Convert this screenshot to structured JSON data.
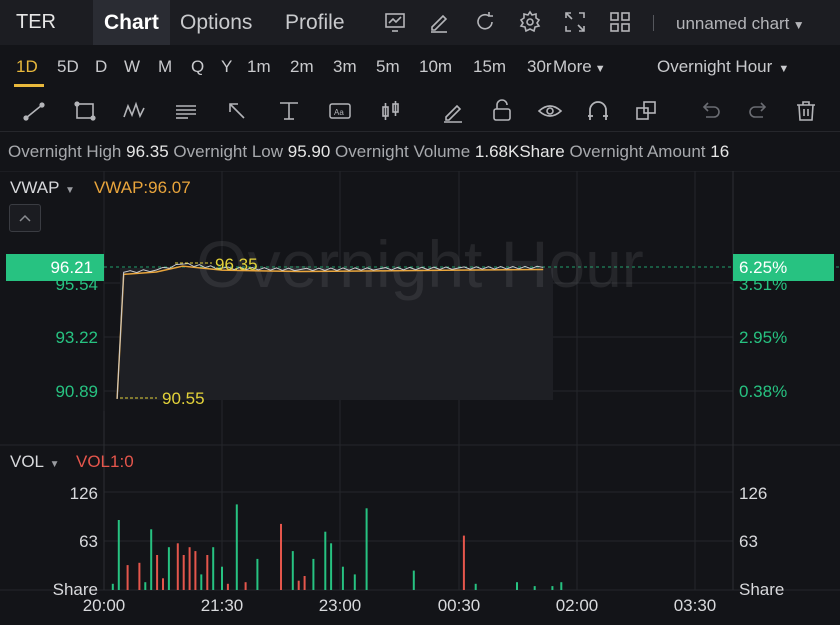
{
  "header": {
    "ticker": "TER",
    "tabs": [
      {
        "label": "Chart",
        "active": true
      },
      {
        "label": "Options",
        "active": false
      },
      {
        "label": "Profile",
        "active": false
      }
    ],
    "icons": [
      "chart-line-icon",
      "edit-icon",
      "refresh-icon",
      "settings-icon",
      "fullscreen-icon",
      "layout-grid-icon"
    ],
    "chart_name": "unnamed chart"
  },
  "periods": {
    "items": [
      "1D",
      "5D",
      "D",
      "W",
      "M",
      "Q",
      "Y",
      "1m",
      "2m",
      "3m",
      "5m",
      "10m",
      "15m",
      "30r",
      "More"
    ],
    "active": "1D",
    "session": "Overnight Hour"
  },
  "drawing_tools": [
    "trend-line-icon",
    "rectangle-icon",
    "pattern-icon",
    "text-note-icon",
    "arrow-icon",
    "price-range-icon",
    "text-box-icon",
    "candle-icon",
    "pen-icon",
    "lock-icon",
    "eye-icon",
    "magnet-icon",
    "layers-icon",
    "undo-icon",
    "redo-icon",
    "trash-icon"
  ],
  "info": {
    "high_label": "Overnight High",
    "high_value": "96.35",
    "low_label": "Overnight Low",
    "low_value": "95.90",
    "volume_label": "Overnight Volume",
    "volume_value": "1.68KShare",
    "amount_label": "Overnight Amount",
    "amount_value": "16"
  },
  "price_pane": {
    "indicator": "VWAP",
    "indicator_value": "VWAP:96.07",
    "watermark": "Overnight Hour",
    "current_price": "96.21",
    "current_pct": "6.25%",
    "left_ticks": [
      "95.54",
      "93.22",
      "90.89"
    ],
    "right_ticks": [
      "3.51%",
      "2.95%",
      "0.38%"
    ],
    "high_marker": "96.35",
    "low_marker": "90.55"
  },
  "volume_pane": {
    "indicator": "VOL",
    "indicator_value": "VOL1:0",
    "left_ticks": [
      "126",
      "63",
      "Share"
    ],
    "right_ticks": [
      "126",
      "63",
      "Share"
    ]
  },
  "time_axis": [
    "20:00",
    "21:30",
    "23:00",
    "00:30",
    "02:00",
    "03:30"
  ],
  "colors": {
    "up": "#27c281",
    "down": "#e5564c",
    "vwap": "#e9a53c",
    "accent": "#e9b93c",
    "marker": "#e3d23a",
    "price_badge": "#27c281"
  },
  "chart_data": {
    "type": "line",
    "price_series": [
      {
        "x": "20:10",
        "y": 90.55
      },
      {
        "x": "20:15",
        "y": 96.0
      },
      {
        "x": "20:40",
        "y": 96.1
      },
      {
        "x": "21:00",
        "y": 96.35
      },
      {
        "x": "21:30",
        "y": 96.18
      },
      {
        "x": "22:30",
        "y": 96.12
      },
      {
        "x": "23:30",
        "y": 96.15
      },
      {
        "x": "00:30",
        "y": 96.18
      },
      {
        "x": "01:35",
        "y": 96.21
      }
    ],
    "volume_bars": [
      {
        "t": 0.15,
        "v": 8,
        "up": true
      },
      {
        "t": 0.25,
        "v": 90,
        "up": true
      },
      {
        "t": 0.4,
        "v": 32,
        "up": false
      },
      {
        "t": 0.6,
        "v": 35,
        "up": false
      },
      {
        "t": 0.7,
        "v": 10,
        "up": true
      },
      {
        "t": 0.8,
        "v": 78,
        "up": true
      },
      {
        "t": 0.9,
        "v": 45,
        "up": false
      },
      {
        "t": 1.0,
        "v": 15,
        "up": false
      },
      {
        "t": 1.1,
        "v": 55,
        "up": true
      },
      {
        "t": 1.25,
        "v": 60,
        "up": false
      },
      {
        "t": 1.35,
        "v": 45,
        "up": false
      },
      {
        "t": 1.45,
        "v": 55,
        "up": false
      },
      {
        "t": 1.55,
        "v": 50,
        "up": false
      },
      {
        "t": 1.65,
        "v": 20,
        "up": true
      },
      {
        "t": 1.75,
        "v": 45,
        "up": false
      },
      {
        "t": 1.85,
        "v": 55,
        "up": true
      },
      {
        "t": 2.0,
        "v": 30,
        "up": true
      },
      {
        "t": 2.1,
        "v": 8,
        "up": false
      },
      {
        "t": 2.25,
        "v": 110,
        "up": true
      },
      {
        "t": 2.4,
        "v": 10,
        "up": false
      },
      {
        "t": 2.6,
        "v": 40,
        "up": true
      },
      {
        "t": 3.0,
        "v": 85,
        "up": false
      },
      {
        "t": 3.2,
        "v": 50,
        "up": true
      },
      {
        "t": 3.3,
        "v": 12,
        "up": false
      },
      {
        "t": 3.4,
        "v": 18,
        "up": false
      },
      {
        "t": 3.55,
        "v": 40,
        "up": true
      },
      {
        "t": 3.75,
        "v": 75,
        "up": true
      },
      {
        "t": 3.85,
        "v": 60,
        "up": true
      },
      {
        "t": 4.05,
        "v": 30,
        "up": true
      },
      {
        "t": 4.25,
        "v": 20,
        "up": true
      },
      {
        "t": 4.45,
        "v": 105,
        "up": true
      },
      {
        "t": 5.25,
        "v": 25,
        "up": true
      },
      {
        "t": 6.1,
        "v": 70,
        "up": false
      },
      {
        "t": 6.3,
        "v": 8,
        "up": true
      },
      {
        "t": 7.0,
        "v": 10,
        "up": true
      },
      {
        "t": 7.3,
        "v": 5,
        "up": true
      },
      {
        "t": 7.6,
        "v": 5,
        "up": true
      },
      {
        "t": 7.75,
        "v": 10,
        "up": true
      }
    ],
    "xlabel": "",
    "ylabel": ""
  }
}
